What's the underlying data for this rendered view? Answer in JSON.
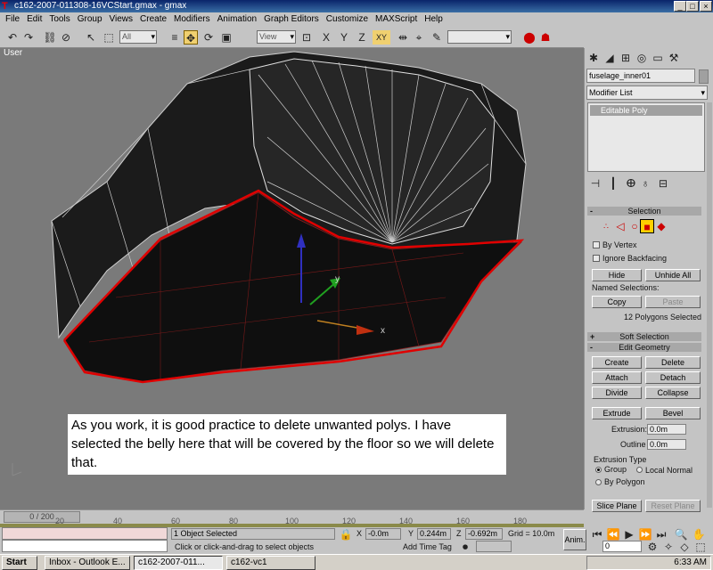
{
  "window": {
    "title": "c162-2007-011308-16VCStart.gmax - gmax",
    "app_icon": "gmax-icon",
    "controls": [
      "_",
      "□",
      "×"
    ]
  },
  "menu": [
    "File",
    "Edit",
    "Tools",
    "Group",
    "Views",
    "Create",
    "Modifiers",
    "Animation",
    "Graph Editors",
    "Customize",
    "MAXScript",
    "Help"
  ],
  "toolbar": {
    "selection_filter": "All",
    "reference_coord": "View",
    "named_selection": ""
  },
  "viewport": {
    "label": "User",
    "axis_x": "x",
    "axis_y": "y",
    "background_color": "#7a7a7a",
    "selection_color": "#e00000"
  },
  "caption": "As you work, it is good practice to delete unwanted polys.  I have selected the belly here that will be covered by the floor so we will delete that.",
  "panel": {
    "object_name": "fuselage_inner01",
    "modifier_list": "Modifier List",
    "stack_item": "Editable Poly",
    "selection": {
      "title": "Selection",
      "by_vertex": "By Vertex",
      "ignore_backfacing": "Ignore Backfacing",
      "hide": "Hide",
      "unhide_all": "Unhide All",
      "named_selections": "Named Selections:",
      "copy": "Copy",
      "paste": "Paste",
      "status": "12 Polygons Selected"
    },
    "soft_selection": "Soft Selection",
    "edit_geometry": {
      "title": "Edit Geometry",
      "create": "Create",
      "delete": "Delete",
      "attach": "Attach",
      "detach": "Detach",
      "divide": "Divide",
      "collapse": "Collapse",
      "extrude": "Extrude",
      "bevel": "Bevel",
      "extrusion_label": "Extrusion:",
      "extrusion_value": "0.0m",
      "outline_label": "Outline",
      "outline_value": "0.0m",
      "extrusion_type": "Extrusion Type",
      "group": "Group",
      "local_normal": "Local Normal",
      "by_polygon": "By Polygon",
      "slice_plane": "Slice Plane",
      "reset_plane": "Reset Plane"
    }
  },
  "timeline": {
    "frame": "0 / 200",
    "ticks": [
      "20",
      "40",
      "60",
      "80",
      "100",
      "120",
      "140",
      "160",
      "180"
    ]
  },
  "status": {
    "selected": "1 Object Selected",
    "prompt": "Click or click-and-drag to select objects",
    "x_value": "-0.0m",
    "y_value": "0.244m",
    "z_value": "-0.692m",
    "grid": "Grid = 10.0m",
    "add_time_tag": "Add Time Tag",
    "anim": "Anim.",
    "frame_field": "0"
  },
  "taskbar": {
    "start": "Start",
    "tasks": [
      "Inbox - Outlook E...",
      "c162-2007-011...",
      "c162-vc1"
    ],
    "clock": "6:33 AM"
  }
}
